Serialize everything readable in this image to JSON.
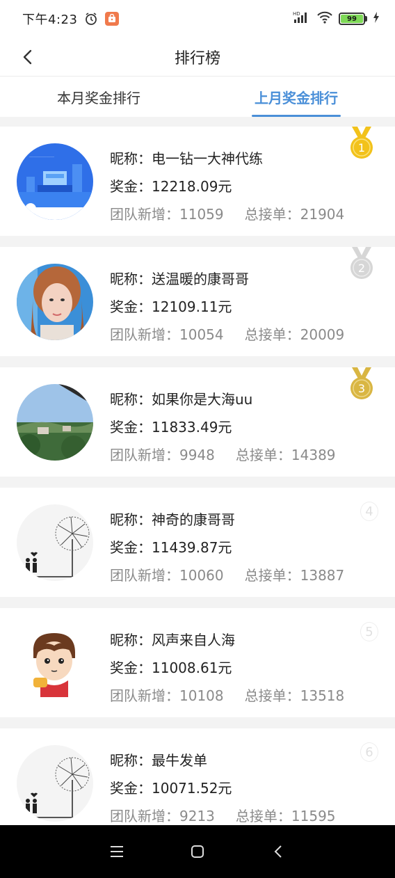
{
  "status_bar": {
    "time": "下午4:23",
    "battery": "99",
    "icons": [
      "alarm-icon",
      "app-badge-icon",
      "hd-signal-icon",
      "wifi-icon",
      "battery-icon",
      "charging-icon"
    ]
  },
  "header": {
    "title": "排行榜"
  },
  "tabs": [
    {
      "label": "本月奖金排行",
      "active": false
    },
    {
      "label": "上月奖金排行",
      "active": true
    }
  ],
  "ranking": [
    {
      "rank": "1",
      "name": "昵称：电一钻一大神代练",
      "bonus": "奖金：12218.09元",
      "team": "团队新增：11059",
      "orders": "总接单：21904",
      "medal": "gold"
    },
    {
      "rank": "2",
      "name": "昵称：送温暖的康哥哥",
      "bonus": "奖金：12109.11元",
      "team": "团队新增：10054",
      "orders": "总接单：20009",
      "medal": "silver"
    },
    {
      "rank": "3",
      "name": "昵称：如果你是大海uu",
      "bonus": "奖金：11833.49元",
      "team": "团队新增：9948",
      "orders": "总接单：14389",
      "medal": "bronze"
    },
    {
      "rank": "4",
      "name": "昵称：神奇的康哥哥",
      "bonus": "奖金：11439.87元",
      "team": "团队新增：10060",
      "orders": "总接单：13887",
      "medal": "none"
    },
    {
      "rank": "5",
      "name": "昵称：风声来自人海",
      "bonus": "奖金：11008.61元",
      "team": "团队新增：10108",
      "orders": "总接单：13518",
      "medal": "none"
    },
    {
      "rank": "6",
      "name": "昵称：最牛发单",
      "bonus": "奖金：10071.52元",
      "team": "团队新增：9213",
      "orders": "总接单：11595",
      "medal": "none"
    }
  ],
  "colors": {
    "accent": "#4a8fd8",
    "gold": "#f2c21b",
    "silver": "#d6d6d6",
    "bronze": "#d9b643"
  }
}
